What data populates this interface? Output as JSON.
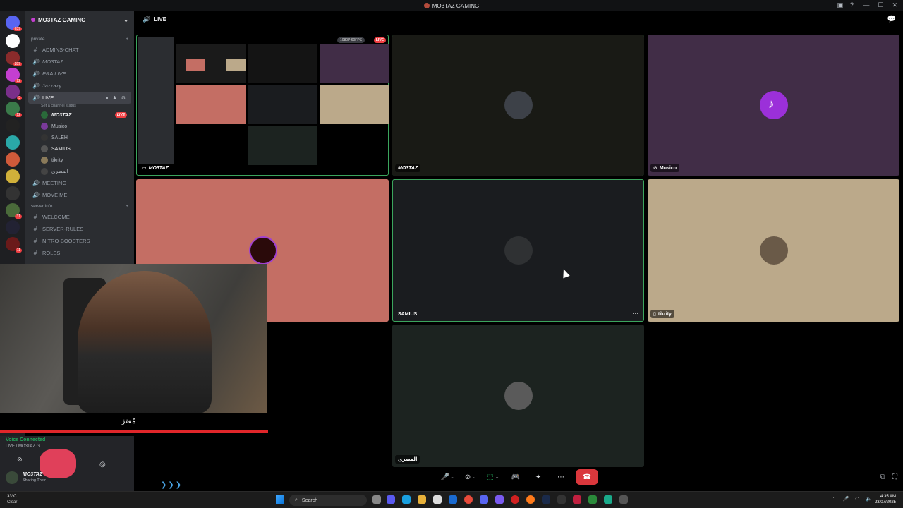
{
  "window": {
    "title": "MO3TAZ GAMING",
    "controls": [
      "—",
      "☐",
      "✕"
    ]
  },
  "server_rail": {
    "badges": [
      "639",
      "289",
      "92",
      "3",
      "12",
      "31",
      "11"
    ]
  },
  "sidebar": {
    "guild_name": "MO3TAZ GAMING",
    "category_private": "private",
    "channels": [
      {
        "name": "ADMINS-CHAT",
        "icon": "#"
      },
      {
        "name": "MO3TAZ",
        "icon": "🔊"
      },
      {
        "name": "PRA LIVE",
        "icon": "🔊"
      },
      {
        "name": "Jazzazy",
        "icon": "🔊"
      }
    ],
    "active_channel": {
      "name": "LIVE",
      "status": "Set a channel status"
    },
    "voice_users": [
      {
        "name": "MO3TAZ",
        "live": "LIVE"
      },
      {
        "name": "Musico"
      },
      {
        "name": "SALEH"
      },
      {
        "name": "SAMIUS"
      },
      {
        "name": "tikrity"
      },
      {
        "name": "المصري"
      }
    ],
    "channels2": [
      {
        "name": "MEETING",
        "icon": "🔊"
      },
      {
        "name": "MOVE ME",
        "icon": "🔊"
      }
    ],
    "category_info": "server info",
    "text_channels": [
      {
        "name": "WELCOME",
        "icon": "#"
      },
      {
        "name": "SERVER-RULES",
        "icon": "#"
      },
      {
        "name": "NITRO-BOOSTERS",
        "icon": "#"
      },
      {
        "name": "ROLES",
        "icon": "#"
      }
    ]
  },
  "main": {
    "header": "LIVE",
    "stream_quality": "1080P 60FPS",
    "live_badge": "LIVE",
    "tiles": [
      {
        "name": "MO3TAZ",
        "bg": "#000000"
      },
      {
        "name": "MO3TAZ",
        "bg": "#191a15"
      },
      {
        "name": "Musico",
        "bg": "#412d47"
      },
      {
        "name": "SALEH",
        "bg": "#c46e64"
      },
      {
        "name": "SAMIUS",
        "bg": "#1a1c1f"
      },
      {
        "name": "tikrity",
        "bg": "#bba98a"
      },
      {
        "name": "المصري",
        "bg": "#1c2320"
      }
    ]
  },
  "webcam": {
    "signature": "مُعتز"
  },
  "voice_panel": {
    "status": "Voice Connected",
    "location": "LIVE / MO3TAZ G",
    "user": "MO3TAZ",
    "user_status": "Sharing Their"
  },
  "controls": [
    "🎤",
    "⊘",
    "⬚",
    "🎮",
    "✦",
    "⋯",
    "☎"
  ],
  "taskbar": {
    "temp": "33°C",
    "weather": "Clear",
    "search_placeholder": "Search",
    "time": "4:35 AM",
    "date": "23/07/2025"
  }
}
